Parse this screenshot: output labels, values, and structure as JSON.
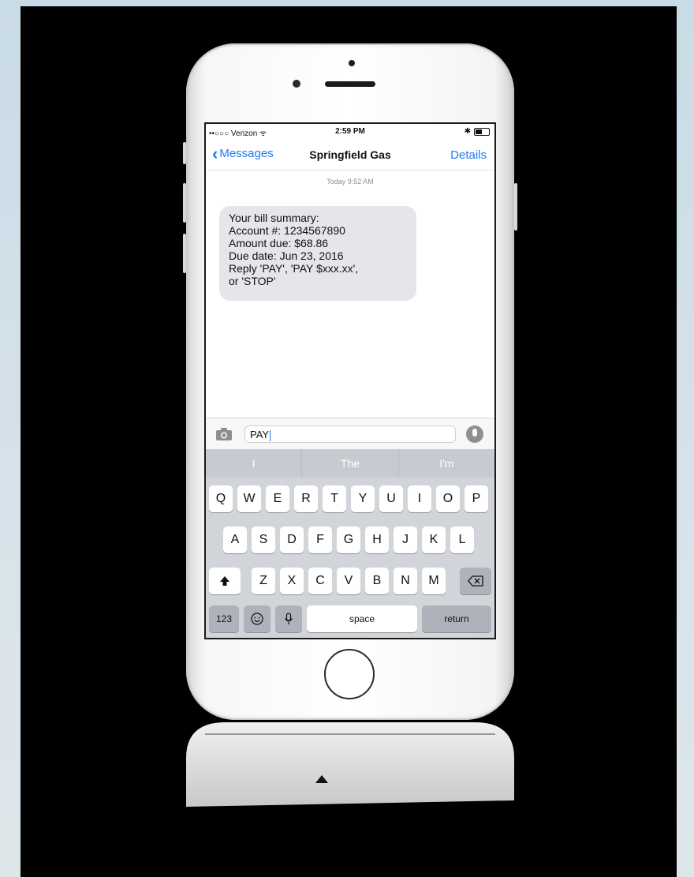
{
  "status_bar": {
    "carrier": "••○○○ Verizon ᯤ",
    "time": "2:59 PM",
    "bluetooth": "✱"
  },
  "nav": {
    "back_label": "Messages",
    "title": "Springfield Gas",
    "details_label": "Details"
  },
  "thread": {
    "timestamp": "Today 9:52 AM",
    "message_lines": [
      "Your bill summary:",
      "Account #: 1234567890",
      "Amount due: $68.86",
      "Due date: Jun 23, 2016",
      "Reply 'PAY', 'PAY $xxx.xx',",
      "or 'STOP'"
    ]
  },
  "compose": {
    "value": "PAY"
  },
  "keyboard": {
    "suggestions": [
      "I",
      "The",
      "I'm"
    ],
    "row1": [
      "Q",
      "W",
      "E",
      "R",
      "T",
      "Y",
      "U",
      "I",
      "O",
      "P"
    ],
    "row2": [
      "A",
      "S",
      "D",
      "F",
      "G",
      "H",
      "J",
      "K",
      "L"
    ],
    "row3": [
      "Z",
      "X",
      "C",
      "V",
      "B",
      "N",
      "M"
    ],
    "numbers_label": "123",
    "space_label": "space",
    "return_label": "return"
  }
}
